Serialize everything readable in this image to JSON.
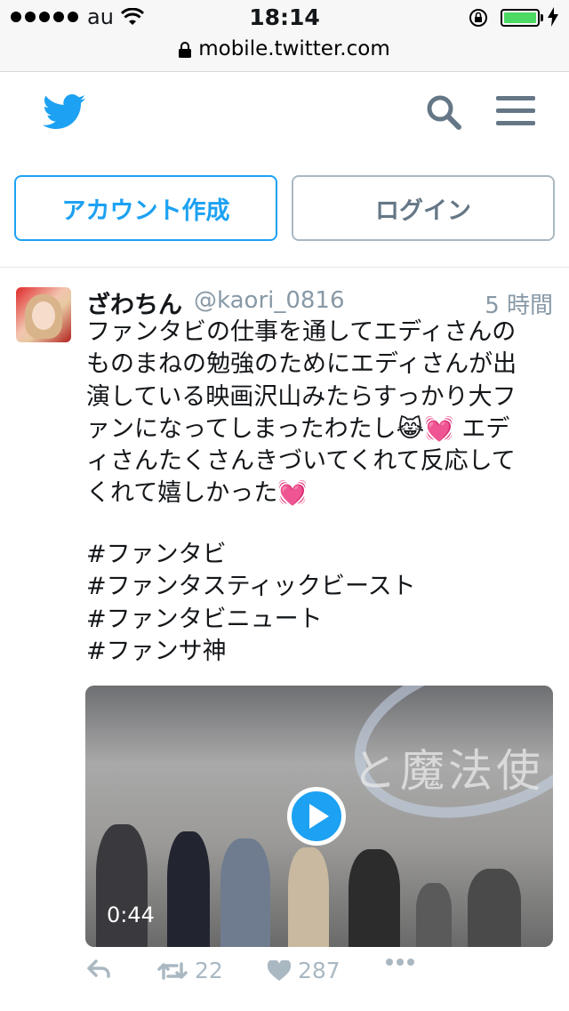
{
  "status_bar": {
    "carrier": "au",
    "time": "18:14",
    "url": "mobile.twitter.com"
  },
  "header": {
    "signup_label": "アカウント作成",
    "login_label": "ログイン"
  },
  "tweet": {
    "display_name": "ざわちん",
    "handle": "@kaori_0816",
    "time_ago": "5 時間",
    "body_lines": [
      "ファンタビの仕事を通してエディさんの",
      "ものまねの勉強のためにエディさんが出",
      "演している映画沢山みたらすっかり大フ",
      "ァンになってしまったわたし😹💓 エデ",
      "ィさんたくさんきづいてくれて反応して",
      "くれて嬉しかった💓"
    ],
    "hashtags": [
      "#ファンタビ",
      "#ファンタスティックビースト",
      "#ファンタビニュート",
      "#ファンサ神"
    ],
    "video": {
      "duration": "0:44",
      "screen_text": "と魔法使"
    },
    "retweet_count": "22",
    "like_count": "287"
  },
  "colors": {
    "brand": "#1da1f2",
    "muted": "#8899a6",
    "icon_grey": "#aab8c2"
  }
}
